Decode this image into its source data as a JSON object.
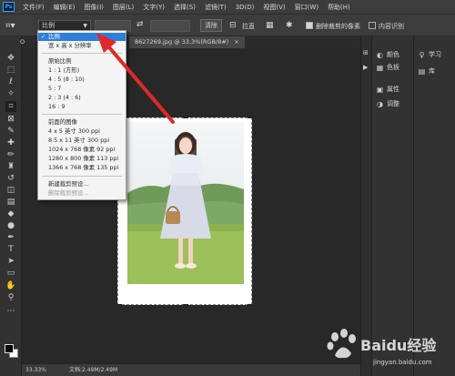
{
  "app": {
    "logo": "Ps"
  },
  "menu": [
    "文件(F)",
    "编辑(E)",
    "图像(I)",
    "图层(L)",
    "文字(Y)",
    "选择(S)",
    "滤镜(T)",
    "3D(D)",
    "视图(V)",
    "窗口(W)",
    "帮助(H)"
  ],
  "options": {
    "ratio_value": "比例",
    "clear_label": "清除",
    "straighten_label": "拉直",
    "delete_cropped_label": "删除裁剪的像素",
    "delete_cropped_checked": true,
    "content_aware_label": "内容识别",
    "content_aware_checked": false
  },
  "document": {
    "tab_left": "O",
    "tab_title": "8627269.jpg @ 33.3%(RGB/8#)",
    "tab_close": "×"
  },
  "dropdown": {
    "selected": "比例",
    "items": [
      "宽 x 高 x 分辨率",
      "原始比例",
      "1 : 1 (方形)",
      "4 : 5 (8 : 10)",
      "5 : 7",
      "2 : 3 (4 : 6)",
      "16 : 9",
      "前面的图像",
      "4 x 5 英寸 300 ppi",
      "8.5 x 11 英寸 300 ppi",
      "1024 x 768 像素 92 ppi",
      "1280 x 800 像素 113 ppi",
      "1366 x 768 像素 135 ppi",
      "新建裁剪预设...",
      "删除裁剪预设..."
    ]
  },
  "panels": {
    "color": "颜色",
    "swatches": "色板",
    "properties": "属性",
    "adjustments": "调整",
    "learn": "学习",
    "libraries": "库"
  },
  "status": {
    "zoom": "33.33%",
    "doc": "文档:2.49M/2.49M"
  },
  "watermark": {
    "brand": "Baidu经验",
    "url": "jingyan.baidu.com"
  },
  "colors": {
    "accent": "#2f7fd9",
    "arrow": "#e02828",
    "sky": "#e8eef3",
    "grass": "#9cc05a"
  }
}
